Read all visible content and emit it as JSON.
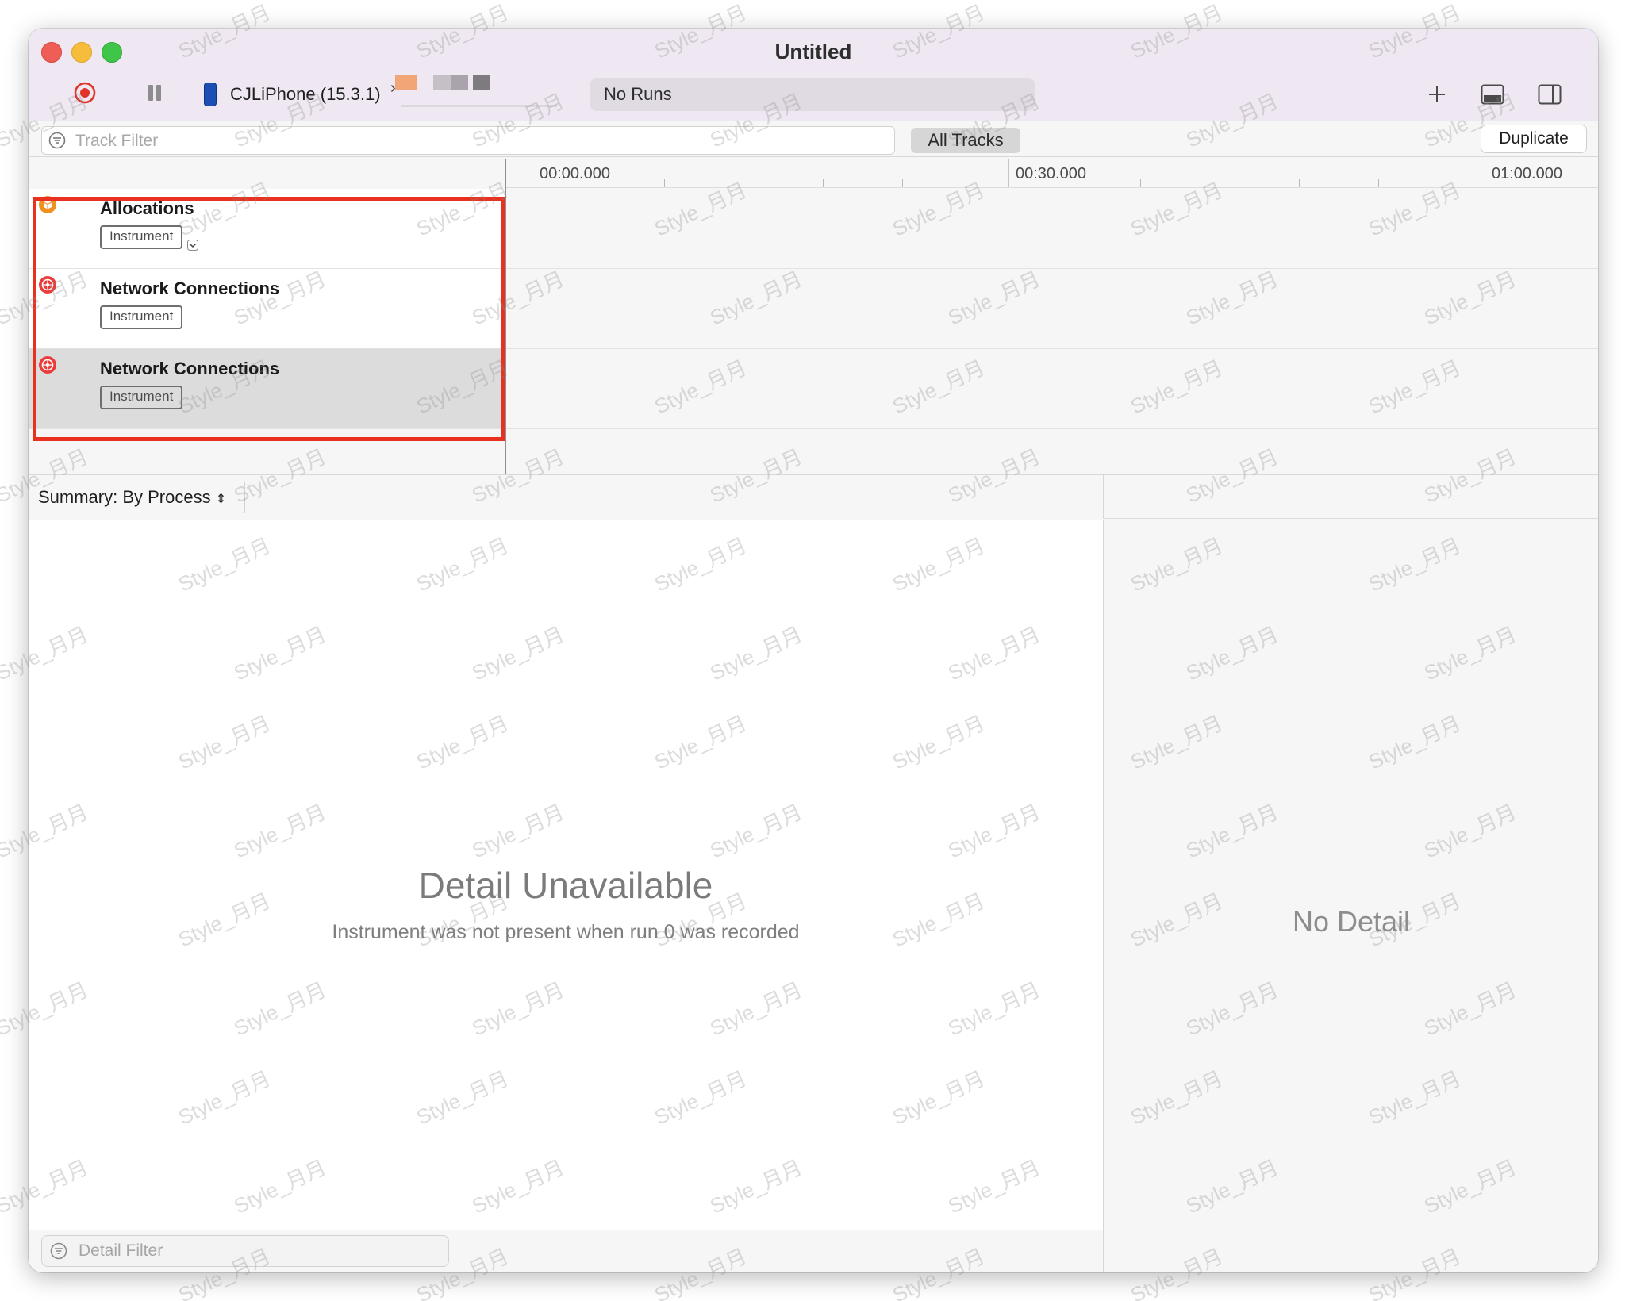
{
  "window": {
    "title": "Untitled",
    "device": "CJLiPhone (15.3.1)",
    "device_chevron": "›",
    "run_selector": "No Runs"
  },
  "filter": {
    "track_filter_placeholder": "Track Filter",
    "all_tracks": "All Tracks",
    "duplicate": "Duplicate"
  },
  "timeline": {
    "labels": [
      "00:00.000",
      "00:30.000",
      "01:00.000"
    ]
  },
  "tracks": [
    {
      "name": "Allocations",
      "tag": "Instrument",
      "icon": "allocations-icon",
      "color": "#f0901f"
    },
    {
      "name": "Network Connections",
      "tag": "Instrument",
      "icon": "network-icon",
      "color": "#ec3b3b"
    },
    {
      "name": "Network Connections",
      "tag": "Instrument",
      "icon": "network-icon",
      "color": "#ec3b3b"
    }
  ],
  "summary": {
    "label": "Summary: By Process",
    "chevron": "⌃⌄"
  },
  "detail": {
    "title": "Detail Unavailable",
    "subtitle": "Instrument was not present when run 0 was recorded",
    "side_empty": "No Detail",
    "filter_placeholder": "Detail Filter"
  },
  "watermark_text": "Style_月月",
  "colors": {
    "highlight": "#e8321f",
    "record": "#e0342a",
    "device_blue": "#1b4fb3"
  }
}
